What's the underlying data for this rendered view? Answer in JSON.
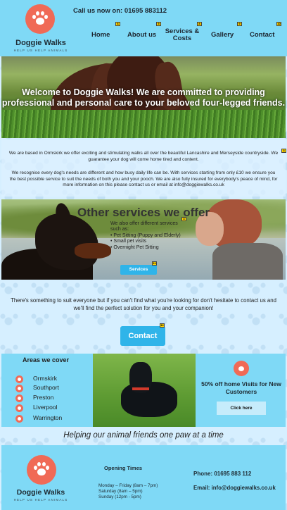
{
  "header": {
    "logo_name": "Doggie Walks",
    "logo_tagline": "HELP US HELP ANIMALS",
    "call_text": "Call us now on: 01695 883112",
    "nav": [
      {
        "label": "Home",
        "badge": "6"
      },
      {
        "label": "About us",
        "badge": "5"
      },
      {
        "label": "Services & Costs",
        "badge": "8"
      },
      {
        "label": "Gallery",
        "badge": "9"
      },
      {
        "label": "Contact",
        "badge": "10"
      }
    ]
  },
  "hero": {
    "text": "Welcome to Doggie Walks! We are committed to providing professional and personal care to your beloved four-legged friends."
  },
  "intro": {
    "paragraph1": "We are based in Ormskirk we offer exciting and stimulating walks all over the beautiful Lancashire and Merseyside countryside. We guarantee your dog will come home tired and content.",
    "paragraph2": "We recognise every dog's needs are different and how busy daily life can be. With services starting from only £10 we ensure you the best possible service to suit the needs of both you and your pooch. We are also fully insured for everybody's peace of mind, for more information on this please contact us or email at info@doggiewalks.co.uk",
    "badge": "3"
  },
  "services": {
    "title": "Other services we offer",
    "list": [
      "We also offer different services such as:",
      "• Pet Sitting (Puppy and Elderly)",
      "• Small pet visits",
      "• Overnight Pet Sitting"
    ],
    "button": "Services",
    "badge": "3",
    "button_badge": "11"
  },
  "cta": {
    "text": "There's something to suit everyone but if you can't find what you're looking for don't hesitate to contact us and we'll find the perfect solution for you and your companion!",
    "button": "Contact",
    "button_badge": "12"
  },
  "areas": {
    "title": "Areas we cover",
    "items": [
      "Ormskirk",
      "Southport",
      "Preston",
      "Liverpool",
      "Warrington"
    ]
  },
  "offer": {
    "text": "50% off home Visits for New Customers",
    "button": "Click here"
  },
  "slogan": "Helping our animal friends one paw at a time",
  "footer": {
    "logo_name": "Doggie Walks",
    "logo_tagline": "HELP US HELP ANIMALS",
    "hours_title": "Opening Times",
    "hours": [
      "Monday – Friday (8am – 7pm)",
      "Saturday (8am – 5pm)",
      "Sunday (12pm - 5pm)"
    ],
    "phone": "Phone: 01695 883 112",
    "email": "Email: info@doggiewalks.co.uk"
  },
  "colors": {
    "header_bg": "#7fd9f6",
    "logo_coral": "#f06a56",
    "button_blue": "#2fb4e9",
    "badge_yellow": "#ffd400"
  },
  "icons": [
    "paw-icon"
  ]
}
